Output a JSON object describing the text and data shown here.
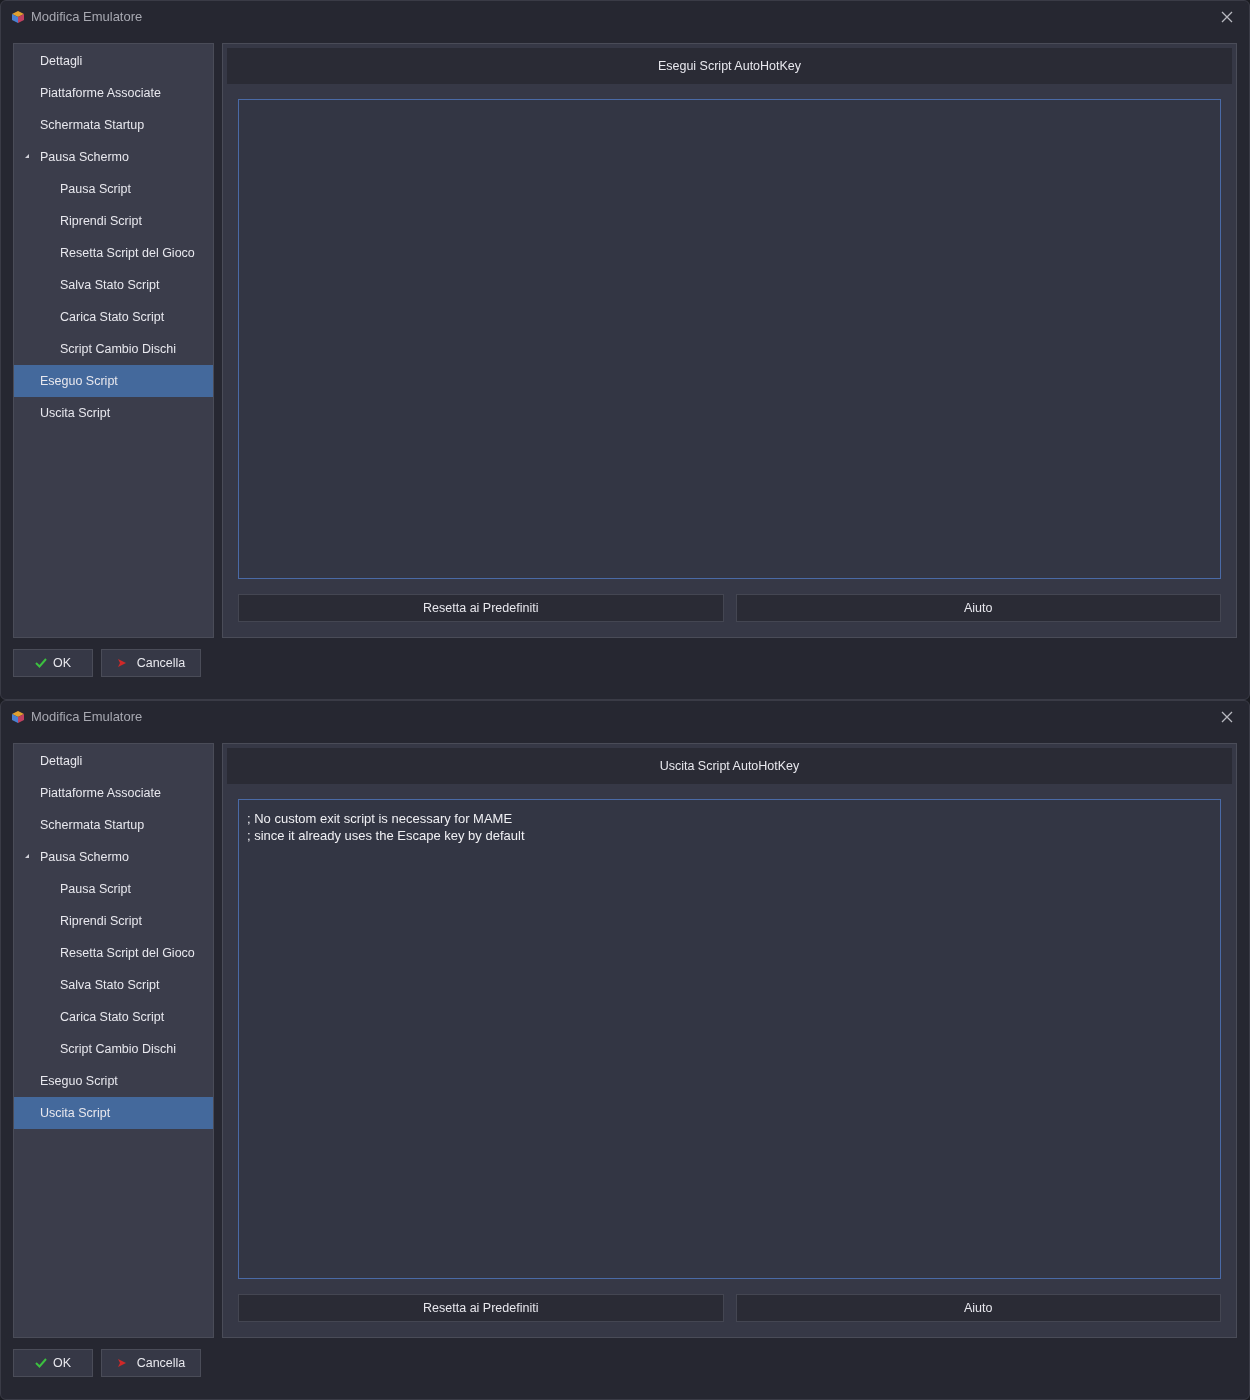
{
  "windows": [
    {
      "title": "Modifica Emulatore",
      "nav": [
        {
          "label": "Dettagli",
          "selected": false
        },
        {
          "label": "Piattaforme Associate",
          "selected": false
        },
        {
          "label": "Schermata Startup",
          "selected": false
        },
        {
          "label": "Pausa Schermo",
          "selected": false,
          "expanded": true,
          "children": [
            {
              "label": "Pausa Script",
              "selected": false
            },
            {
              "label": "Riprendi Script",
              "selected": false
            },
            {
              "label": "Resetta Script del Gioco",
              "selected": false
            },
            {
              "label": "Salva Stato Script",
              "selected": false
            },
            {
              "label": "Carica Stato Script",
              "selected": false
            },
            {
              "label": "Script Cambio Dischi",
              "selected": false
            }
          ]
        },
        {
          "label": "Eseguo Script",
          "selected": true
        },
        {
          "label": "Uscita Script",
          "selected": false
        }
      ],
      "header": "Esegui Script AutoHotKey",
      "buttons": [
        "Resetta ai Predefiniti",
        "Aiuto"
      ],
      "ok": "OK",
      "cancel": "Cancella"
    },
    {
      "title": "Modifica Emulatore",
      "nav": [
        {
          "label": "Dettagli",
          "selected": false
        },
        {
          "label": "Piattaforme Associate",
          "selected": false
        },
        {
          "label": "Schermata Startup",
          "selected": false
        },
        {
          "label": "Pausa Schermo",
          "selected": false,
          "expanded": true,
          "children": [
            {
              "label": "Pausa Script",
              "selected": false
            },
            {
              "label": "Riprendi Script",
              "selected": false
            },
            {
              "label": "Resetta Script del Gioco",
              "selected": false
            },
            {
              "label": "Salva Stato Script",
              "selected": false
            },
            {
              "label": "Carica Stato Script",
              "selected": false
            },
            {
              "label": "Script Cambio Dischi",
              "selected": false
            }
          ]
        },
        {
          "label": "Eseguo Script",
          "selected": false
        },
        {
          "label": "Uscita Script",
          "selected": true
        }
      ],
      "header": "Uscita Script AutoHotKey",
      "script": "; No custom exit script is necessary for MAME\n; since it already uses the Escape key by default",
      "buttons": [
        "Resetta ai Predefiniti",
        "Aiuto"
      ],
      "ok": "OK",
      "cancel": "Cancella"
    }
  ]
}
